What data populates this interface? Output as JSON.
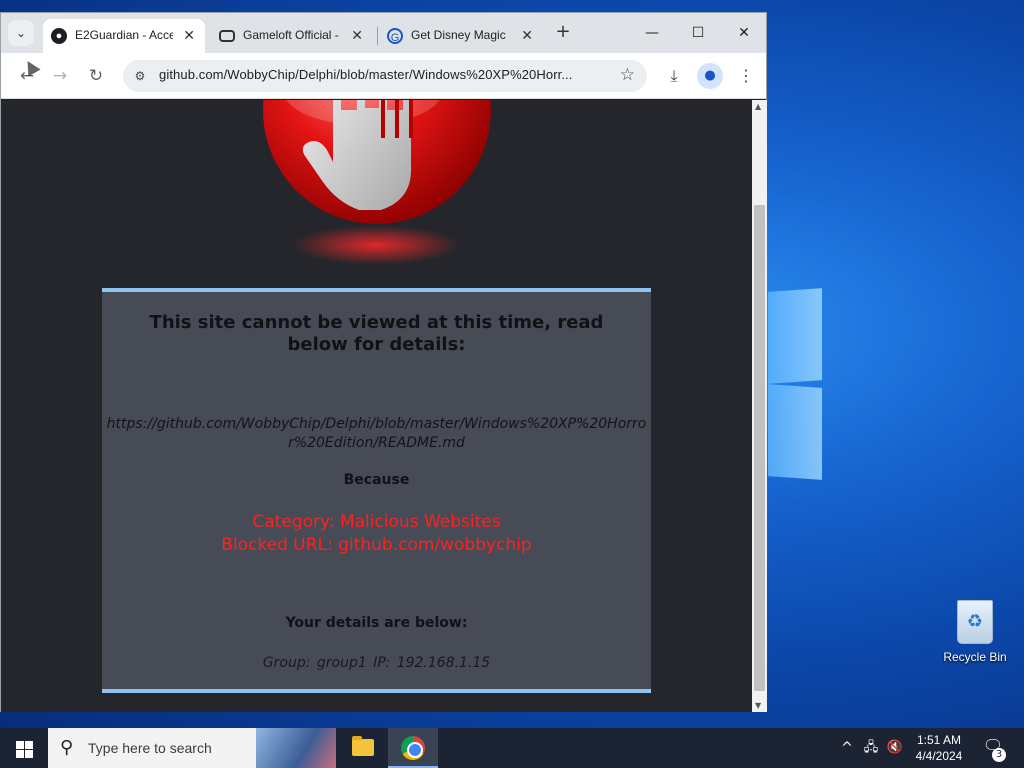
{
  "desktop": {
    "recycle_bin_label": "Recycle Bin"
  },
  "browser": {
    "tabs": [
      {
        "title": "E2Guardian - Acce",
        "icon": "github-icon",
        "active": true
      },
      {
        "title": "Gameloft Official -",
        "icon": "gameloft-icon",
        "active": false
      },
      {
        "title": "Get Disney Magic",
        "icon": "disney-icon",
        "active": false
      }
    ],
    "url": "github.com/WobbyChip/Delphi/blob/master/Windows%20XP%20Horr...",
    "colors": {
      "tabstrip": "#dfe3e8",
      "page_bg": "#24262b"
    }
  },
  "page": {
    "heading": "This site cannot be viewed at this time, read below for details:",
    "blocked_url": "https://github.com/WobbyChip/Delphi/blob/master/Windows%20XP%20Horror%20Edition/README.md",
    "because": "Because",
    "category": "Category: Malicious Websites",
    "blocked_reason": "Blocked URL: github.com/wobbychip",
    "details_heading": "Your details are below:",
    "details": "Group: group1   IP: 192.168.1.15",
    "colors": {
      "panel": "#474b56",
      "panel_border": "#8ec2f0",
      "alert_text": "#ff2020"
    }
  },
  "taskbar": {
    "search_placeholder": "Type here to search",
    "time": "1:51 AM",
    "date": "4/4/2024",
    "notification_count": "3"
  }
}
